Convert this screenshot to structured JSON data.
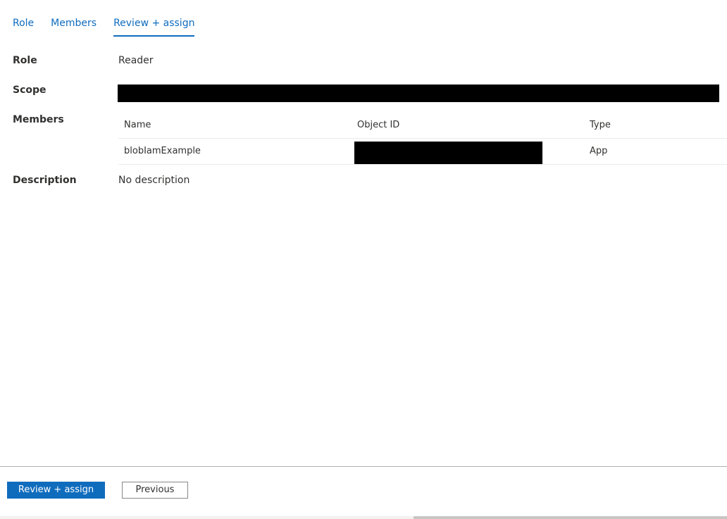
{
  "tabs": [
    {
      "label": "Role"
    },
    {
      "label": "Members"
    },
    {
      "label": "Review + assign",
      "active": true
    }
  ],
  "review": {
    "role_label": "Role",
    "role_value": "Reader",
    "scope_label": "Scope",
    "scope_value_redacted": true,
    "members_label": "Members",
    "description_label": "Description",
    "description_value": "No description"
  },
  "members_table": {
    "columns": [
      "Name",
      "Object ID",
      "Type"
    ],
    "rows": [
      {
        "name": "blobIamExample",
        "object_id_redacted": true,
        "type": "App"
      }
    ]
  },
  "footer": {
    "primary_button": "Review + assign",
    "secondary_button": "Previous"
  },
  "colors": {
    "accent": "#0f6cbd",
    "redaction": "#000000"
  }
}
